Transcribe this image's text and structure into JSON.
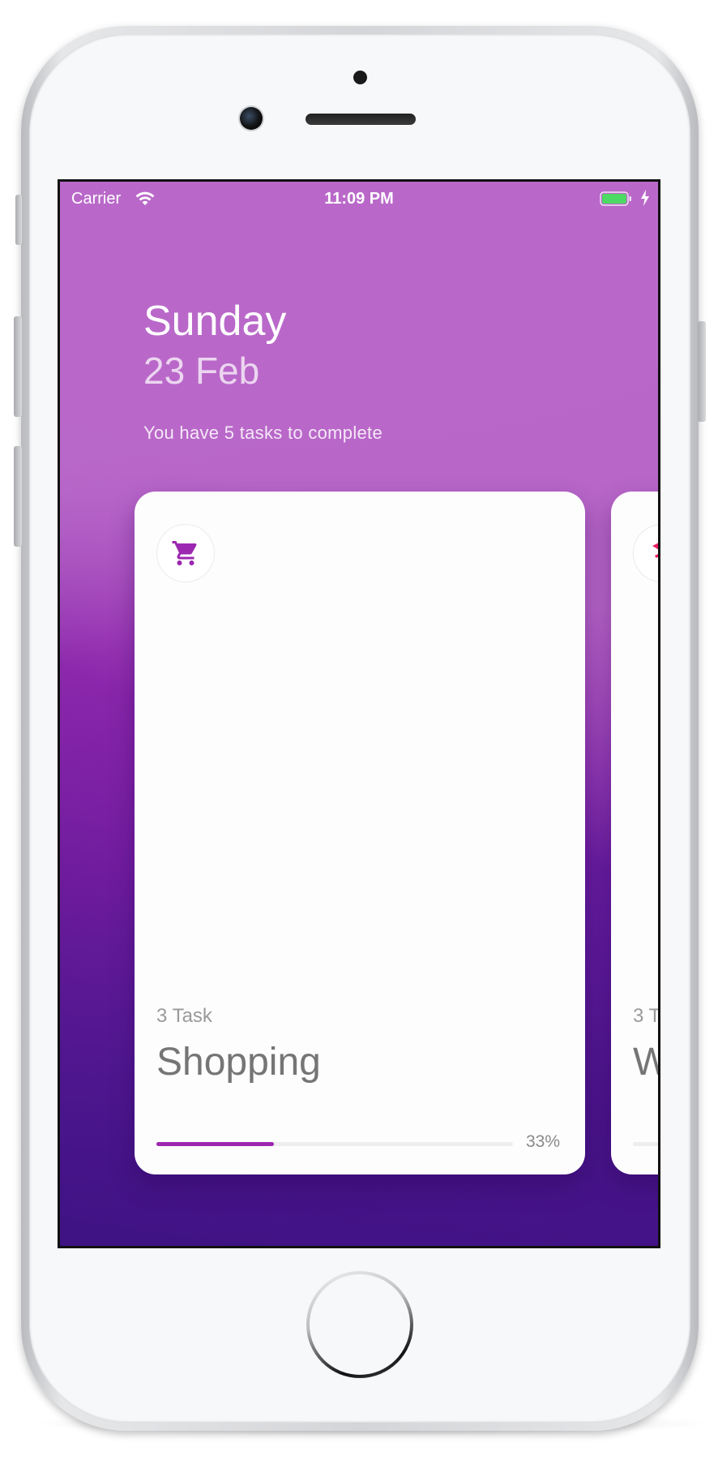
{
  "status_bar": {
    "carrier": "Carrier",
    "time": "11:09 PM",
    "wifi_icon": "wifi-icon",
    "battery_icon": "battery-charging-icon",
    "battery_color": "#4cd964"
  },
  "header": {
    "day": "Sunday",
    "date": "23 Feb",
    "subtitle": "You have 5 tasks to complete"
  },
  "cards": [
    {
      "icon": "shopping-cart-icon",
      "icon_color": "#9c27b0",
      "task_count": "3 Task",
      "title": "Shopping",
      "progress": 0.33,
      "progress_label": "33%",
      "progress_color": "#9c27b0"
    },
    {
      "icon": "category-icon",
      "icon_color": "#e91e63",
      "task_count": "3 T",
      "title": "W"
    }
  ],
  "colors": {
    "gradient_top": "#b868c9",
    "gradient_mid": "#8b22ad",
    "gradient_bottom": "#45138a"
  }
}
